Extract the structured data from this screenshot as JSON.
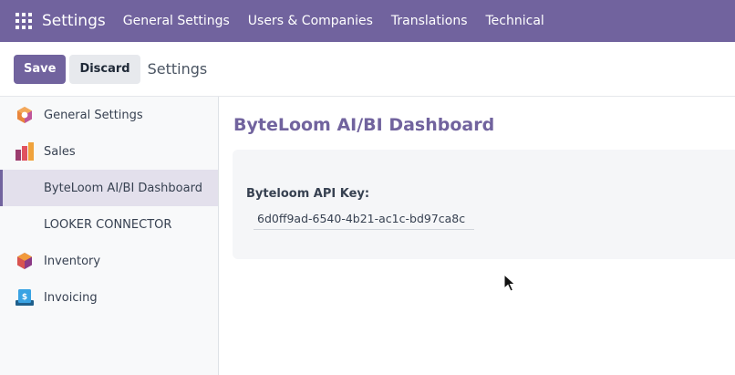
{
  "topbar": {
    "brand": "Settings",
    "menu": [
      "General Settings",
      "Users & Companies",
      "Translations",
      "Technical"
    ]
  },
  "controls": {
    "save_label": "Save",
    "discard_label": "Discard",
    "breadcrumb": "Settings"
  },
  "sidebar": {
    "items": [
      {
        "label": "General Settings",
        "icon": "odoo-settings-icon"
      },
      {
        "label": "Sales",
        "icon": "sales-chart-icon"
      },
      {
        "label": "ByteLoom AI/BI Dashboard",
        "icon": "",
        "active": true
      },
      {
        "label": "LOOKER CONNECTOR",
        "icon": ""
      },
      {
        "label": "Inventory",
        "icon": "inventory-box-icon"
      },
      {
        "label": "Invoicing",
        "icon": "invoicing-icon"
      }
    ]
  },
  "main": {
    "title": "ByteLoom AI/BI Dashboard",
    "field_label": "Byteloom API Key:",
    "field_value": "6d0ff9ad-6540-4b21-ac1c-bd97ca8c"
  },
  "colors": {
    "brand": "#71639e",
    "active_bg": "#e3e0ec"
  }
}
